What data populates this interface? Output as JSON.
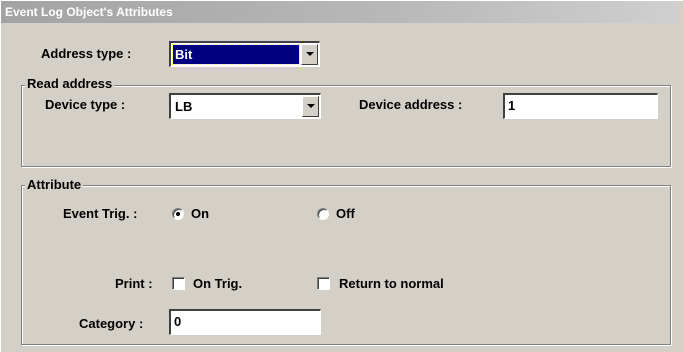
{
  "window": {
    "title": "Event Log Object's Attributes"
  },
  "address_type": {
    "label": "Address type :",
    "value": "Bit"
  },
  "read_address": {
    "legend": "Read address",
    "device_type_label": "Device type :",
    "device_type_value": "LB",
    "device_address_label": "Device address :",
    "device_address_value": "1"
  },
  "attribute": {
    "legend": "Attribute",
    "event_trig_label": "Event Trig. :",
    "on_label": "On",
    "on_selected": true,
    "off_label": "Off",
    "print_label": "Print :",
    "on_trig_label": "On Trig.",
    "on_trig_checked": false,
    "return_normal_label": "Return to normal",
    "return_normal_checked": false,
    "category_label": "Category :",
    "category_value": "0"
  }
}
